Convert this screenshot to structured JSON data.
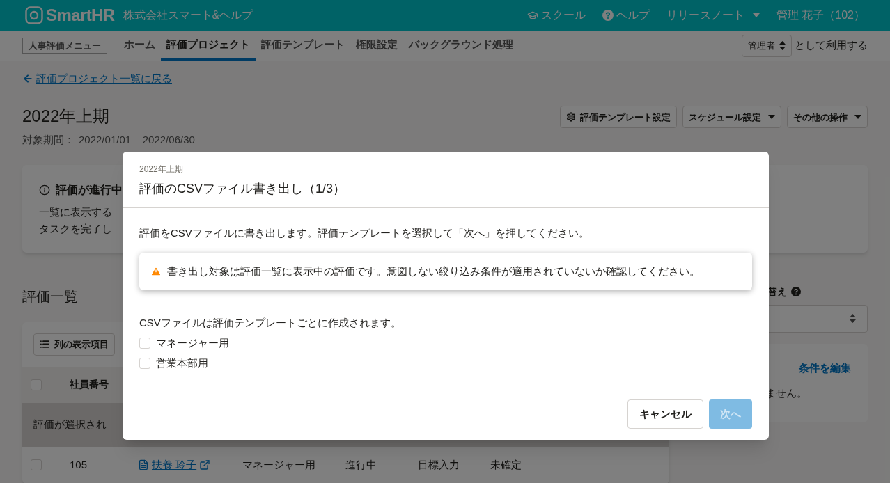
{
  "header": {
    "logo": "SmartHR",
    "company": "株式会社スマート&ヘルプ",
    "links": [
      {
        "label": "スクール",
        "kind": "school"
      },
      {
        "label": "ヘルプ",
        "kind": "help"
      },
      {
        "label": "リリースノート",
        "kind": "dropdown"
      }
    ],
    "user": "管理 花子（102）"
  },
  "nav": {
    "menu_label": "人事評価メニュー",
    "tabs": [
      {
        "label": "ホーム",
        "selected": false
      },
      {
        "label": "評価プロジェクト",
        "selected": true
      },
      {
        "label": "評価テンプレート",
        "selected": false
      },
      {
        "label": "権限設定",
        "selected": false
      },
      {
        "label": "バックグラウンド処理",
        "selected": false
      }
    ],
    "role_select": {
      "value": "管理者"
    },
    "role_suffix": "として利用する"
  },
  "back_link": "評価プロジェクト一覧に戻る",
  "project": {
    "title": "2022年上期",
    "period_label": "対象期間：",
    "period": "2022/01/01 – 2022/06/30",
    "actions": [
      {
        "label": "評価テンプレート設定",
        "kind": "settings"
      },
      {
        "label": "スケジュール設定",
        "kind": "dropdown"
      },
      {
        "label": "その他の操作",
        "kind": "dropdown"
      }
    ]
  },
  "notice": {
    "title": "評価が進行中",
    "lines": [
      "一覧に表示する",
      "タスクを完了し"
    ]
  },
  "list": {
    "title": "評価一覧",
    "column_button": "列の表示項目",
    "header_checked": false,
    "columns": [
      {
        "label": "社員番号"
      }
    ],
    "selection_notice": "評価が選択され",
    "rows": [
      {
        "checked": false,
        "cells": [
          "105",
          "扶養 玲子",
          "マネージャー用",
          "進行中",
          "目標入力",
          "未確定"
        ]
      }
    ]
  },
  "sidebar": {
    "label": "替え",
    "filter_link": "条件を編集",
    "filter_text": "ません。"
  },
  "modal": {
    "subtitle": "2022年上期",
    "title": "評価のCSVファイル書き出し（1/3）",
    "description": "評価をCSVファイルに書き出します。評価テンプレートを選択して「次へ」を押してください。",
    "warning": "書き出し対象は評価一覧に表示中の評価です。意図しない絞り込み条件が適用されていないか確認してください。",
    "note": "CSVファイルは評価テンプレートごとに作成されます。",
    "templates": [
      {
        "label": "マネージャー用",
        "checked": false
      },
      {
        "label": "営業本部用",
        "checked": false
      }
    ],
    "buttons": [
      {
        "label": "キャンセル",
        "kind": "secondary",
        "disabled": false
      },
      {
        "label": "次へ",
        "kind": "primary",
        "disabled": true
      }
    ]
  }
}
